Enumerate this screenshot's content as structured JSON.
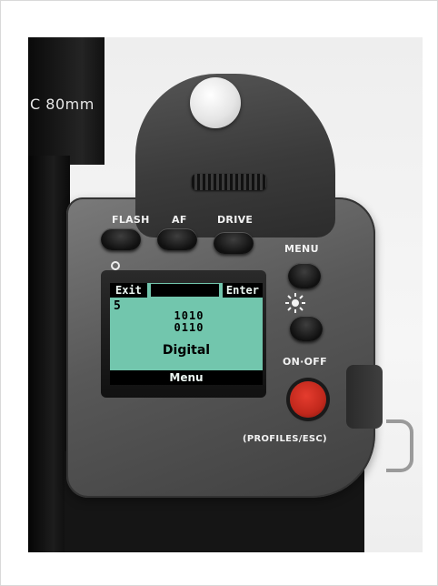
{
  "lens": {
    "marking": "C 80mm"
  },
  "controls": {
    "flash_label": "FLASH",
    "af_label": "AF",
    "drive_label": "DRIVE",
    "menu_label": "MENU",
    "onoff_label": "ON·OFF",
    "profiles_label": "(PROFILES/ESC)"
  },
  "icons": {
    "key": "key-icon",
    "brightness": "sun-icon"
  },
  "lcd": {
    "left_softkey": "Exit",
    "right_softkey": "Enter",
    "value": "5",
    "bits_line1": "1010",
    "bits_line2": "0110",
    "mode": "Digital",
    "bottom_softkey": "Menu",
    "screen_color": "#72c6ad"
  },
  "colors": {
    "power_button": "#c1281c",
    "body": "#585858"
  }
}
